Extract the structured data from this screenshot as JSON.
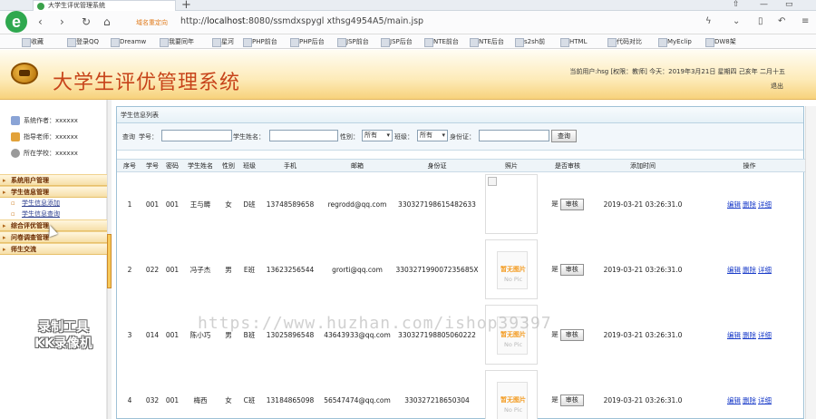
{
  "browser": {
    "tab_title": "大学生评优管理系统",
    "new_tab": "+",
    "url_badge": "域名重定向",
    "url_prefix": "http://",
    "url_host": "localhost",
    "url_rest": ":8080/ssmdxspygl xthsg4954A5/main.jsp",
    "bookmarks": [
      "收藏",
      "登录QQ",
      "Dreamw",
      "我要同年",
      "星河",
      "PHP前台",
      "PHP后台",
      "JSP前台",
      "JSP后台",
      "NTE前台",
      "NTE后台",
      "s2sh前",
      "HTML",
      "代码对比",
      "MyEclip",
      "DW8架"
    ]
  },
  "header": {
    "title": "大学生评优管理系统",
    "user_info": "当前用户:hsg [权限：教师] 今天：2019年3月21日 星期四 己亥年 二月十五",
    "logout": "退出"
  },
  "sidebar": {
    "info": [
      {
        "label": "系统作者：xxxxxx",
        "icon": "user-icon"
      },
      {
        "label": "指导老师：xxxxxx",
        "icon": "teacher-icon"
      },
      {
        "label": "所在学校：xxxxxx",
        "icon": "school-icon"
      }
    ],
    "menu": [
      {
        "label": "系统用户管理"
      },
      {
        "label": "学生信息管理",
        "children": [
          "学生信息添加",
          "学生信息查询"
        ]
      },
      {
        "label": "综合评优管理"
      },
      {
        "label": "问卷调查管理"
      },
      {
        "label": "师生交流"
      }
    ]
  },
  "panel": {
    "title": "学生信息列表",
    "search": {
      "prefix": "查询",
      "student_no_label": "学号：",
      "student_name_label": "学生姓名：",
      "gender_label": "性别：",
      "gender_value": "所有",
      "class_label": "班级：",
      "class_value": "所有",
      "id_label": "身份证：",
      "button": "查询"
    },
    "columns": [
      "序号",
      "学号",
      "密码",
      "学生姓名",
      "性别",
      "班级",
      "手机",
      "邮箱",
      "身份证",
      "照片",
      "是否审核",
      "添加时间",
      "操作"
    ],
    "rows": [
      {
        "idx": "1",
        "no": "001",
        "pwd": "001",
        "name": "王与畴",
        "gender": "女",
        "cls": "D班",
        "phone": "13748589658",
        "email": "regrodd@qq.com",
        "idcard": "330327198615482633",
        "photo": "broken",
        "approved": "是",
        "time": "2019-03-21 03:26:31.0"
      },
      {
        "idx": "2",
        "no": "022",
        "pwd": "001",
        "name": "冯子杰",
        "gender": "男",
        "cls": "E班",
        "phone": "13623256544",
        "email": "grorti@qq.com",
        "idcard": "330327199007235685X",
        "photo": "nopic",
        "approved": "是",
        "time": "2019-03-21 03:26:31.0"
      },
      {
        "idx": "3",
        "no": "014",
        "pwd": "001",
        "name": "陈小巧",
        "gender": "男",
        "cls": "B班",
        "phone": "13025896548",
        "email": "43643933@qq.com",
        "idcard": "330327198805060222",
        "photo": "nopic",
        "approved": "是",
        "time": "2019-03-21 03:26:31.0"
      },
      {
        "idx": "4",
        "no": "032",
        "pwd": "001",
        "name": "梅西",
        "gender": "女",
        "cls": "C班",
        "phone": "13184865098",
        "email": "56547474@qq.com",
        "idcard": "330327218650304",
        "photo": "nopic",
        "approved": "是",
        "time": "2019-03-21 03:26:31.0"
      }
    ],
    "review_btn": "审核",
    "ops": [
      "编辑",
      "删除",
      "详细"
    ],
    "nopic_cn": "暂无图片",
    "nopic_en": "No Pic"
  },
  "overlay": {
    "watermark": "https://www.huzhan.com/ishop39397",
    "recorder_line1": "录制工具",
    "recorder_line2": "KK录像机"
  }
}
